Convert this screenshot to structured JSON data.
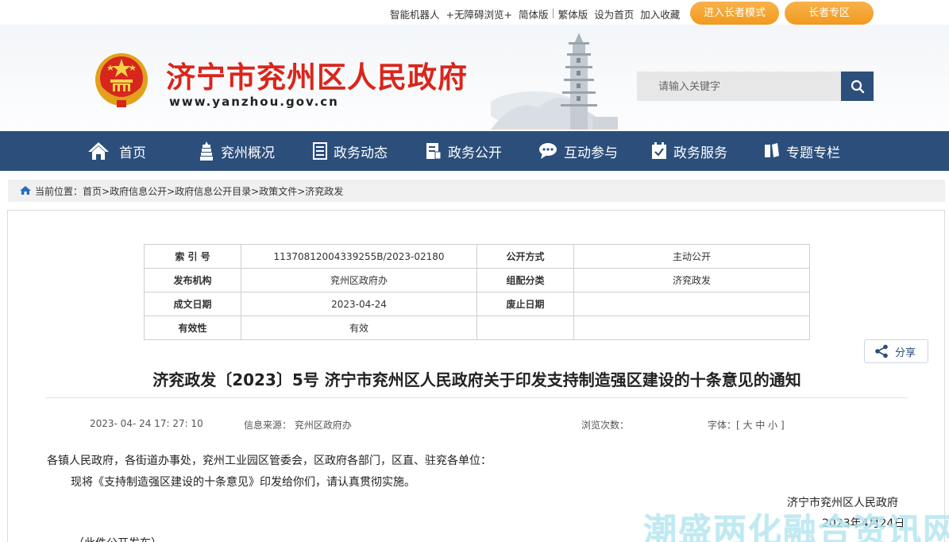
{
  "topbar": {
    "links": [
      "智能机器人",
      "+无障碍浏览+",
      "简体版",
      "繁体版",
      "设为首页",
      "加入收藏"
    ],
    "elder_mode": "进入长者模式",
    "elder_zone": "长者专区"
  },
  "header": {
    "site_title": "济宁市兖州区人民政府",
    "site_url": "www.yanzhou.gov.cn",
    "search_placeholder": "请输入关键字"
  },
  "nav": {
    "items": [
      {
        "label": "首页",
        "icon": "home-icon"
      },
      {
        "label": "兖州概况",
        "icon": "pagoda-icon"
      },
      {
        "label": "政务动态",
        "icon": "document-icon"
      },
      {
        "label": "政务公开",
        "icon": "open-doc-icon"
      },
      {
        "label": "互动参与",
        "icon": "chat-icon"
      },
      {
        "label": "政务服务",
        "icon": "checklist-icon"
      },
      {
        "label": "专题专栏",
        "icon": "book-icon"
      }
    ]
  },
  "breadcrumb": {
    "prefix": "当前位置：",
    "items": [
      "首页>",
      "政府信息公开>",
      "政府信息公开目录>",
      "政策文件>",
      "济兖政发"
    ]
  },
  "meta_table": {
    "rows": [
      {
        "k1": "索 引 号",
        "v1": "11370812004339255B/2023-02180",
        "k2": "公开方式",
        "v2": "主动公开"
      },
      {
        "k1": "发布机构",
        "v1": "兖州区政府办",
        "k2": "组配分类",
        "v2": "济兖政发"
      },
      {
        "k1": "成文日期",
        "v1": "2023-04-24",
        "k2": "废止日期",
        "v2": ""
      },
      {
        "k1": "有效性",
        "v1": "有效",
        "k2": "",
        "v2": ""
      }
    ]
  },
  "share": {
    "label": "分享"
  },
  "document": {
    "title": "济兖政发〔2023〕5号 济宁市兖州区人民政府关于印发支持制造强区建设的十条意见的通知",
    "datetime": "2023- 04- 24 17: 27: 10",
    "source_label": "信息来源：",
    "source": "兖州区政府办",
    "views_label": "浏览次数：",
    "font_label": "字体：[",
    "font_sizes": "大 中 小",
    "font_end": "]",
    "recipients": "各镇人民政府，各街道办事处，兖州工业园区管委会，区政府各部门，区直、驻兖各单位：",
    "paragraph": "现将《支持制造强区建设的十条意见》印发给你们，请认真贯彻实施。",
    "signer": "济宁市兖州区人民政府",
    "sign_date": "2023年4月24日",
    "note": "（此件公开发布）"
  },
  "watermark": "潮盛两化融合资讯网",
  "colors": {
    "nav_bg": "#2c4e7b",
    "title_red": "#d9261c",
    "pill_orange": "#f2a22e"
  }
}
